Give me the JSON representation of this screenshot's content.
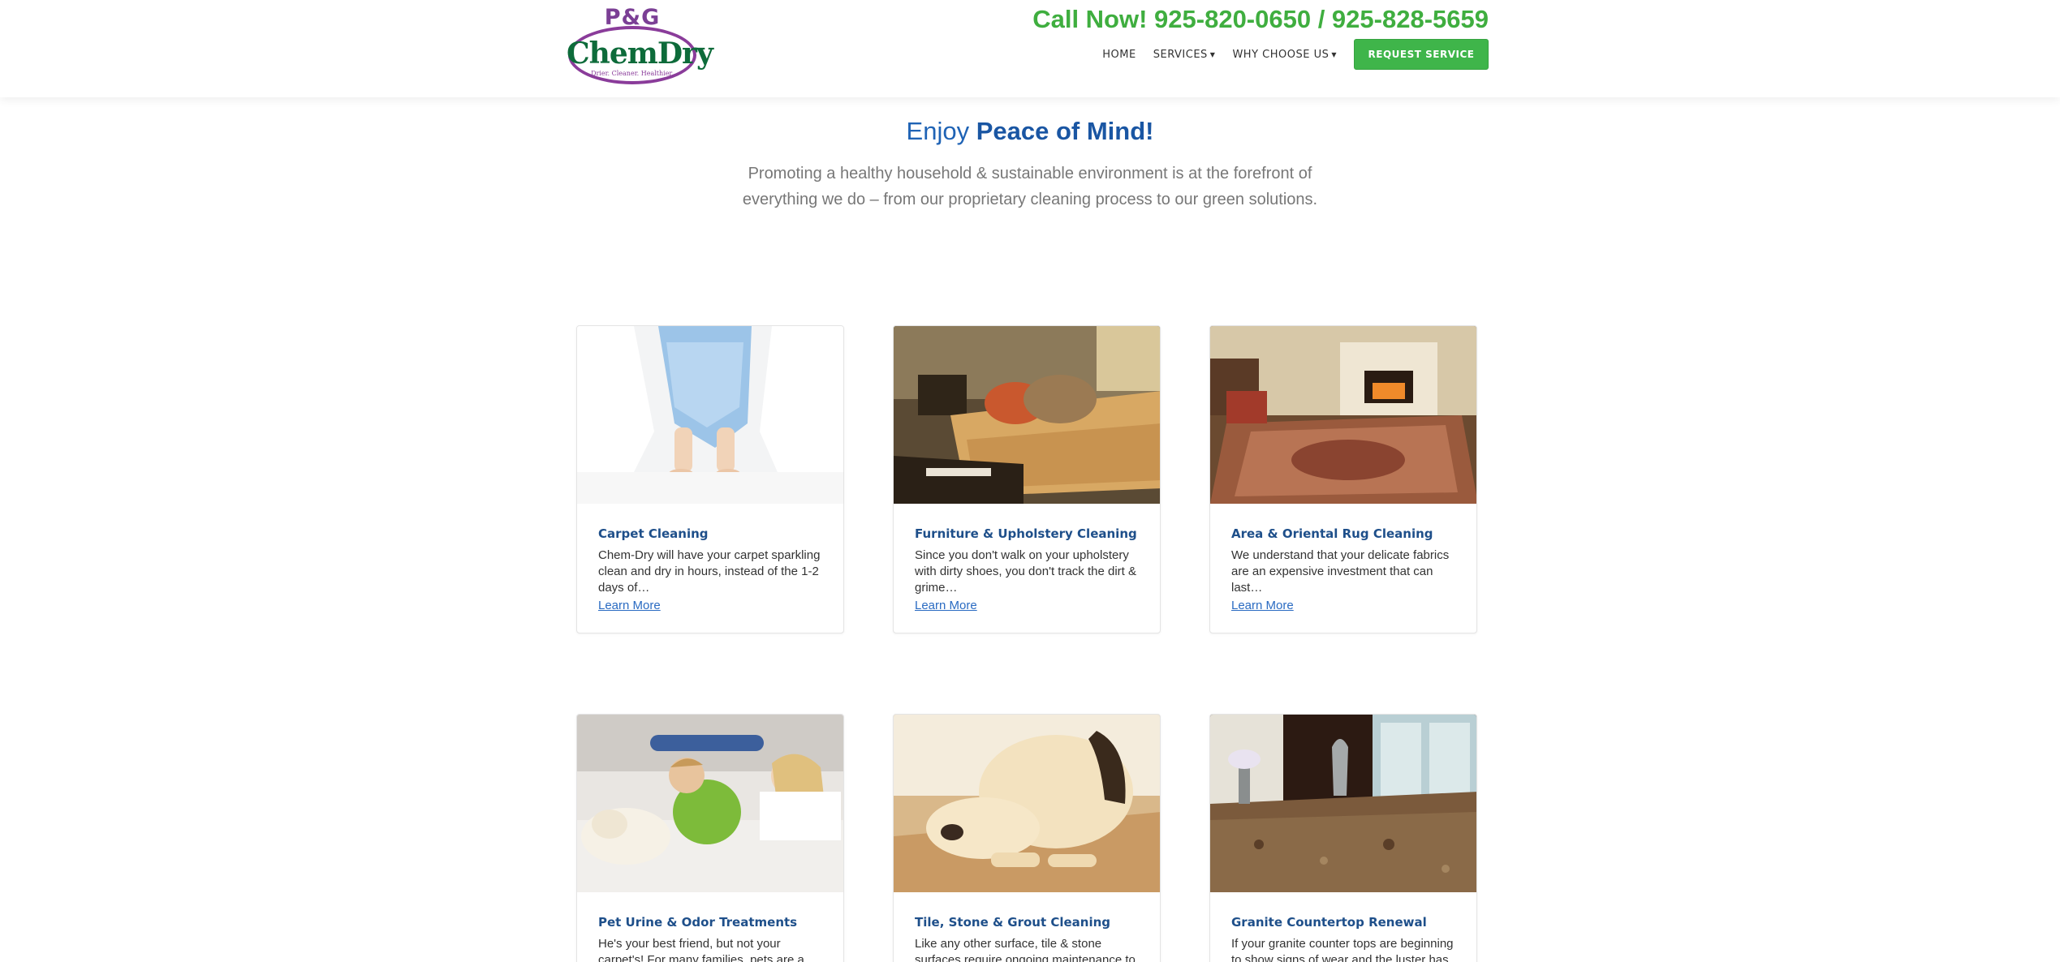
{
  "header": {
    "logo": {
      "top_text": "P&G",
      "main_text": "ChemDry",
      "tagline": "Drier. Cleaner. Healthier."
    },
    "call_now": "Call Now! 925-820-0650 / 925-828-5659",
    "nav": [
      {
        "label": "HOME",
        "has_caret": false
      },
      {
        "label": "SERVICES",
        "has_caret": true
      },
      {
        "label": "WHY CHOOSE US",
        "has_caret": true
      }
    ],
    "request_button": "REQUEST SERVICE"
  },
  "intro": {
    "title_light": "Enjoy",
    "title_bold": "Peace of Mind!",
    "text": "Promoting a healthy household & sustainable environment is at the forefront of everything we do – from our proprietary cleaning process to our green solutions."
  },
  "cards": [
    {
      "title": "Carpet Cleaning",
      "description": "Chem-Dry will have your carpet sparkling clean and dry in hours, instead of the 1-2 days of…",
      "link": "Learn More",
      "image": "baby-feet-on-carpet"
    },
    {
      "title": "Furniture & Upholstery Cleaning",
      "description": "Since you don't walk on your upholstery with dirty shoes, you don't track the dirt & grime…",
      "link": "Learn More",
      "image": "couch-with-pillows"
    },
    {
      "title": "Area & Oriental Rug Cleaning",
      "description": "We understand that your delicate fabrics are an expensive investment that can last…",
      "link": "Learn More",
      "image": "oriental-rug-living-room"
    },
    {
      "title": "Pet Urine & Odor Treatments",
      "description": "He's your best friend, but not your carpet's! For many families, pets are a vital part of",
      "link": "",
      "image": "family-with-dog-on-carpet"
    },
    {
      "title": "Tile, Stone & Grout Cleaning",
      "description": "Like any other surface, tile & stone surfaces require ongoing maintenance to look…",
      "link": "",
      "image": "dog-on-tile-floor"
    },
    {
      "title": "Granite Countertop Renewal",
      "description": "If your granite counter tops are beginning to show signs of wear and the luster has",
      "link": "",
      "image": "granite-kitchen-counter"
    }
  ],
  "colors": {
    "green": "#3fae3f",
    "blue": "#1f63b5",
    "link": "#2a6bc2",
    "purple": "#8a3c9a"
  }
}
